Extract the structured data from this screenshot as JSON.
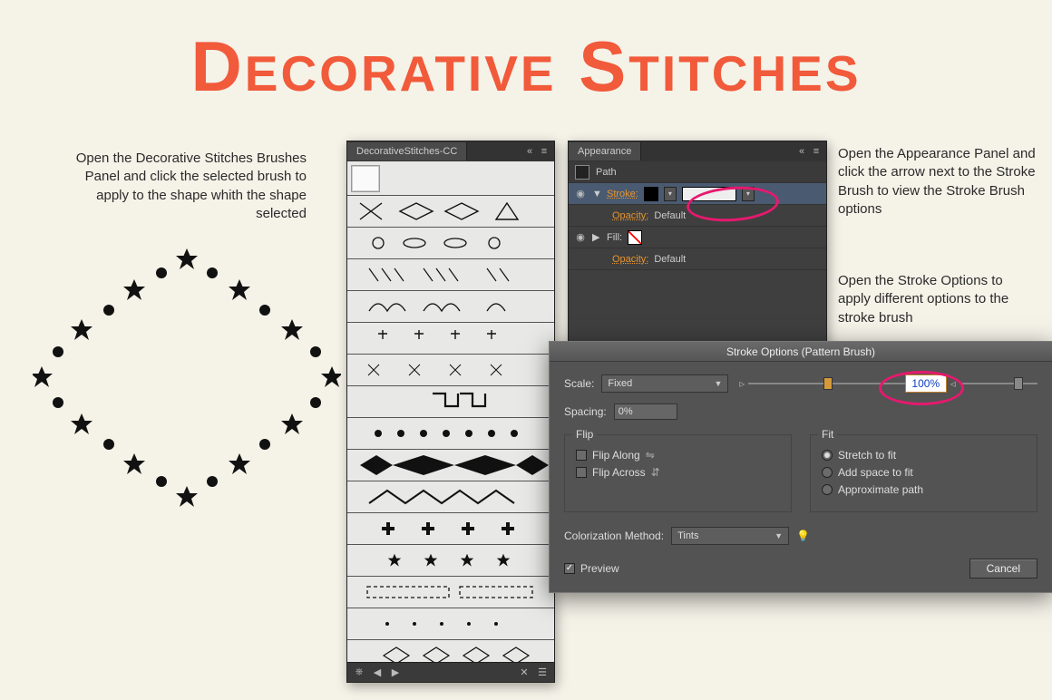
{
  "title": "Decorative Stitches",
  "instructions": {
    "left": "Open the Decorative Stitches Brushes Panel and click the selected brush to apply to the shape whith the shape selected",
    "right1": "Open the Appearance Panel and click the arrow next to the Stroke Brush to view the Stroke Brush options",
    "right2": "Open the Stroke Options to apply different options to the stroke brush"
  },
  "brushes_panel": {
    "tab": "DecorativeStitches-CC"
  },
  "appearance": {
    "tab": "Appearance",
    "path_label": "Path",
    "stroke_label": "Stroke:",
    "fill_label": "Fill:",
    "opacity_label": "Opacity:",
    "opacity_value": "Default"
  },
  "dialog": {
    "title": "Stroke Options (Pattern Brush)",
    "scale_label": "Scale:",
    "scale_mode": "Fixed",
    "scale_value": "100%",
    "spacing_label": "Spacing:",
    "spacing_value": "0%",
    "flip_legend": "Flip",
    "flip_along": "Flip Along",
    "flip_across": "Flip Across",
    "fit_legend": "Fit",
    "fit_stretch": "Stretch to fit",
    "fit_addspace": "Add space to fit",
    "fit_approx": "Approximate path",
    "colorization_label": "Colorization Method:",
    "colorization_value": "Tints",
    "preview_label": "Preview",
    "cancel": "Cancel"
  }
}
